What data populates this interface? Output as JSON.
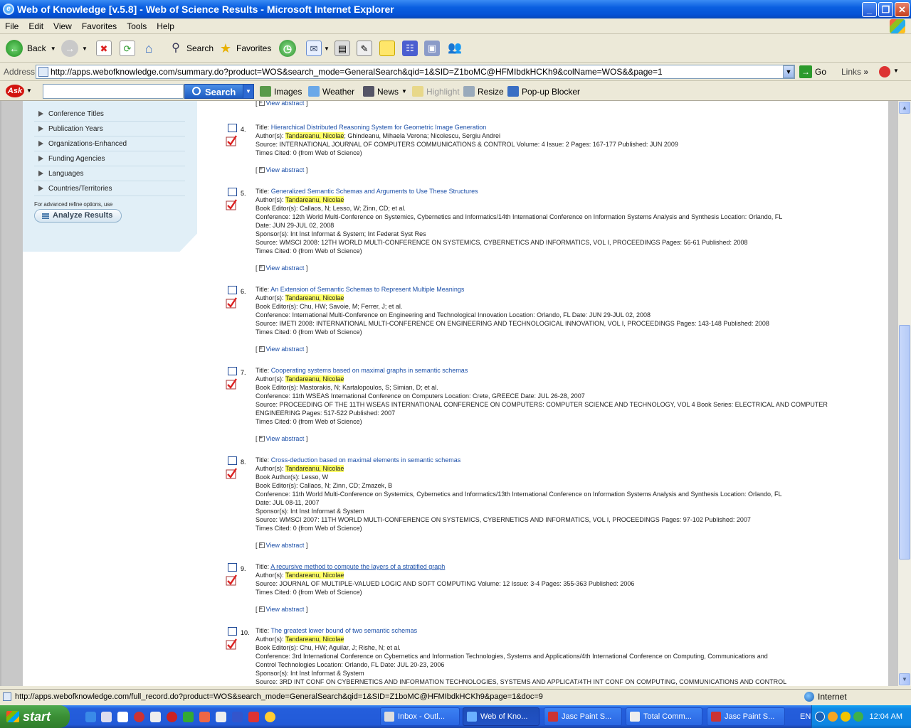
{
  "window": {
    "title": "Web of Knowledge [v.5.8] - Web of Science Results - Microsoft Internet Explorer"
  },
  "menu": [
    "File",
    "Edit",
    "View",
    "Favorites",
    "Tools",
    "Help"
  ],
  "toolbar": {
    "back": "Back",
    "search": "Search",
    "favorites": "Favorites"
  },
  "address": {
    "label": "Address",
    "url": "http://apps.webofknowledge.com/summary.do?product=WOS&search_mode=GeneralSearch&qid=1&SID=Z1boMC@HFMIbdkHCKh9&colName=WOS&&page=1",
    "go": "Go",
    "links": "Links"
  },
  "askbar": {
    "search": "Search",
    "images": "Images",
    "weather": "Weather",
    "news": "News",
    "highlight": "Highlight",
    "resize": "Resize",
    "popup": "Pop-up Blocker"
  },
  "sidebar": {
    "items": [
      "Conference Titles",
      "Publication Years",
      "Organizations-Enhanced",
      "Funding Agencies",
      "Languages",
      "Countries/Territories"
    ],
    "advanced": "For advanced refine options, use",
    "analyze": "Analyze Results"
  },
  "labels": {
    "view_abstract": "View abstract",
    "title": "Title:",
    "authors": "Author(s):",
    "book_authors": "Book Author(s):",
    "editors": "Book Editor(s):",
    "conference": "Conference:",
    "sponsor": "Sponsor(s):",
    "source": "Source:",
    "times_cited": "Times Cited:"
  },
  "records": [
    {
      "num": "4.",
      "title": "Hierarchical Distributed Reasoning System for Geometric Image Generation",
      "author": "Tandareanu, Nicolae",
      "author_rest": "; Ghindeanu, Mihaela Verona; Nicolescu, Sergiu Andrei",
      "source": "INTERNATIONAL JOURNAL OF COMPUTERS COMMUNICATIONS & CONTROL  Volume: 4   Issue: 2   Pages: 167-177   Published: JUN 2009",
      "cited": "0 (from Web of Science)"
    },
    {
      "num": "5.",
      "title": "Generalized Semantic Schemas and Arguments to Use These Structures",
      "author": "Tandareanu, Nicolae",
      "editors": "Callaos, N; Lesso, W; Zinn, CD; et al.",
      "conference": "12th World Multi-Conference on Systemics, Cybernetics and Informatics/14th International Conference on Information Systems Analysis and Synthesis Location: Orlando, FL",
      "conference2": "Date: JUN 29-JUL 02, 2008",
      "sponsor": "Int Inst Informat & System; Int Federat Syst Res",
      "source": "WMSCI 2008: 12TH WORLD MULTI-CONFERENCE ON SYSTEMICS, CYBERNETICS AND INFORMATICS, VOL I, PROCEEDINGS   Pages: 56-61   Published: 2008",
      "cited": "0 (from Web of Science)"
    },
    {
      "num": "6.",
      "title": "An Extension of Semantic Schemas to Represent Multiple Meanings",
      "author": "Tandareanu, Nicolae",
      "editors": "Chu, HW; Savoie, M; Ferrer, J; et al.",
      "conference": "International Multi-Conference on Engineering and Technological Innovation Location: Orlando, FL Date: JUN 29-JUL 02, 2008",
      "source": "IMETI 2008: INTERNATIONAL MULTI-CONFERENCE ON ENGINEERING AND TECHNOLOGICAL INNOVATION, VOL I, PROCEEDINGS   Pages: 143-148   Published: 2008",
      "cited": "0 (from Web of Science)"
    },
    {
      "num": "7.",
      "title": "Cooperating systems based on maximal graphs in semantic schemas",
      "author": "Tandareanu, Nicolae",
      "editors": "Mastorakis, N; Kartalopoulos, S; Simian, D; et al.",
      "conference": "11th WSEAS International Conference on Computers Location: Crete, GREECE Date: JUL 26-28, 2007",
      "source": "PROCEEDING OF THE 11TH WSEAS INTERNATIONAL CONFERENCE ON COMPUTERS: COMPUTER SCIENCE AND TECHNOLOGY, VOL 4  Book Series: ELECTRICAL AND COMPUTER",
      "source2": "ENGINEERING    Pages: 517-522    Published: 2007",
      "cited": "0 (from Web of Science)"
    },
    {
      "num": "8.",
      "title": "Cross-deduction based on maximal elements in semantic schemas",
      "author": "Tandareanu, Nicolae",
      "book_authors": "Lesso, W",
      "editors": "Callaos, N; Zinn, CD; Zmazek, B",
      "conference": "11th World Multi-Conference on Systemics, Cybernetics and Informatics/13th International Conference on Information Systems Analysis and Synthesis Location: Orlando, FL",
      "conference2": "Date: JUL 08-11, 2007",
      "sponsor": "Int Inst Informat & System",
      "source": "WMSCI 2007: 11TH WORLD MULTI-CONFERENCE ON SYSTEMICS, CYBERNETICS AND INFORMATICS, VOL I, PROCEEDINGS   Pages: 97-102   Published: 2007",
      "cited": "0 (from Web of Science)"
    },
    {
      "num": "9.",
      "title": "A recursive method to compute the layers of a stratified graph",
      "author": "Tandareanu, Nicolae",
      "source": "JOURNAL OF MULTIPLE-VALUED LOGIC AND SOFT COMPUTING   Volume: 12   Issue: 3-4   Pages: 355-363   Published: 2006",
      "cited": "0 (from Web of Science)"
    },
    {
      "num": "10.",
      "title": "The greatest lower bound of two semantic schemas",
      "author": "Tandareanu, Nicolae",
      "editors": "Chu, HW; Aguilar, J; Rishe, N; et al.",
      "conference": "3rd International Conference on Cybernetics and Information Technologies, Systems and Applications/4th International Conference on Computing, Communications and",
      "conference2": "Control Technologies Location: Orlando, FL Date: JUL 20-23, 2006",
      "sponsor": "Int Inst Informat & System",
      "source": "3RD INT CONF ON CYBERNETICS AND INFORMATION TECHNOLOGIES, SYSTEMS AND APPLICAT/4TH INT CONF ON COMPUTING, COMMUNICATIONS AND CONTROL"
    }
  ],
  "status": {
    "url": "http://apps.webofknowledge.com/full_record.do?product=WOS&search_mode=GeneralSearch&qid=1&SID=Z1boMC@HFMIbdkHCKh9&page=1&doc=9",
    "zone": "Internet"
  },
  "taskbar": {
    "start": "start",
    "tasks": [
      "Inbox - Outl...",
      "Web of Kno...",
      "Jasc Paint S...",
      "Total Comm...",
      "Jasc Paint S..."
    ],
    "lang": "EN",
    "clock": "12:04 AM"
  }
}
